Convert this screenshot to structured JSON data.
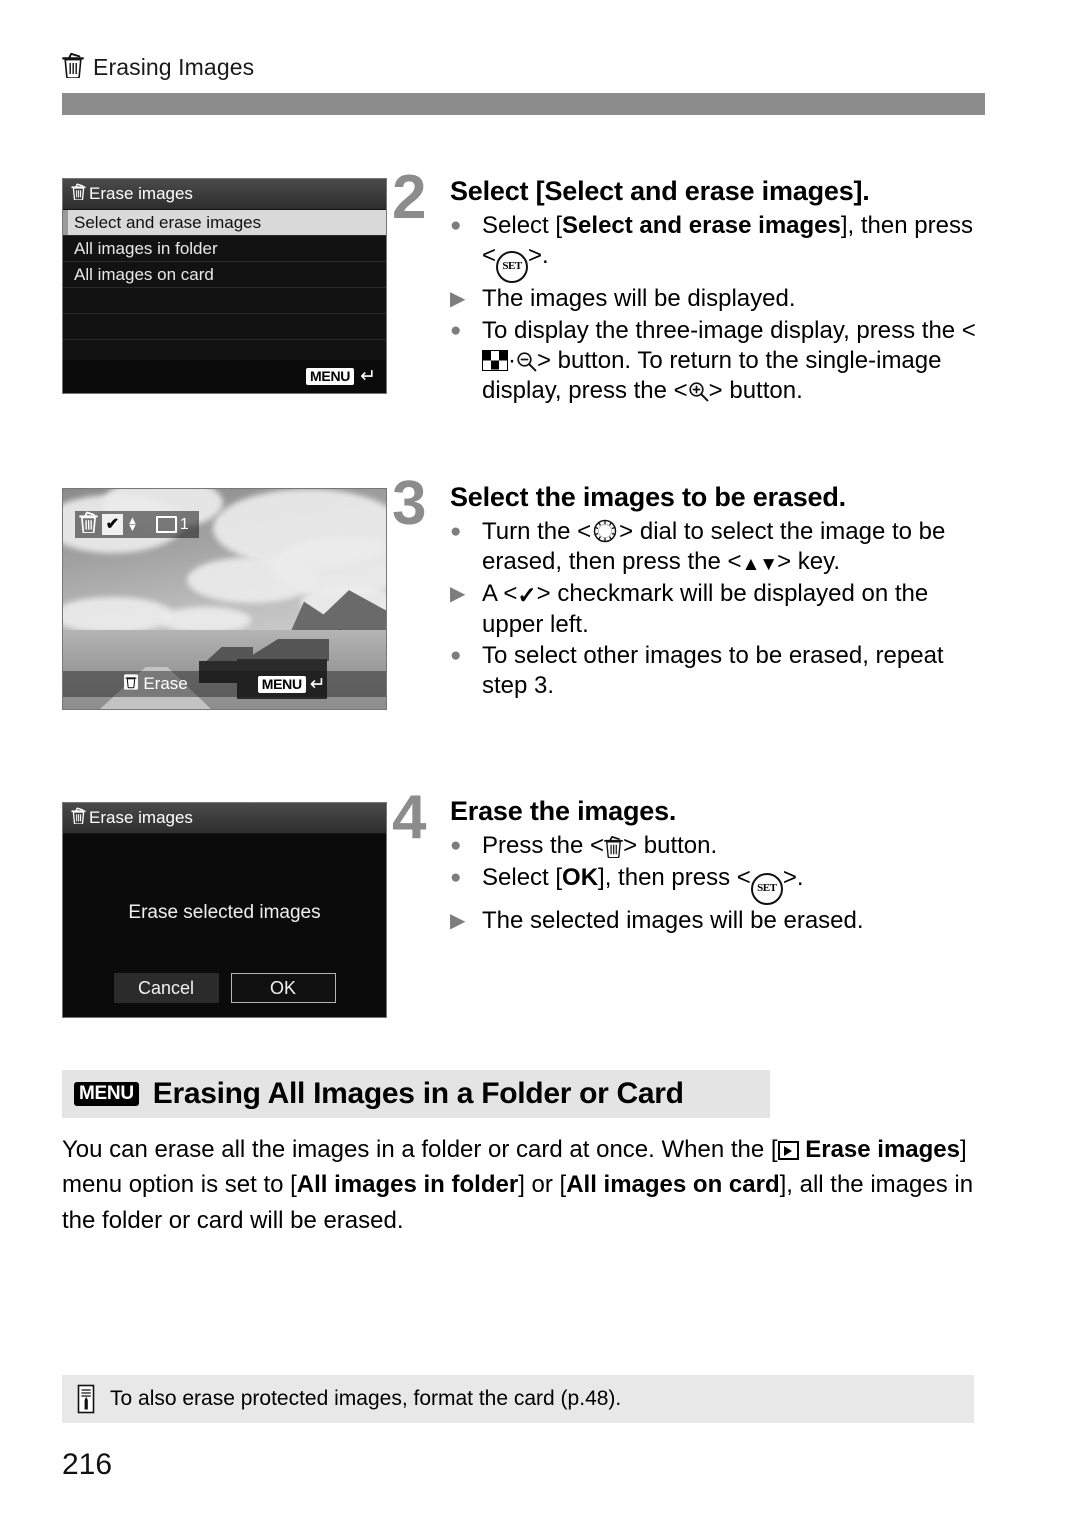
{
  "header": {
    "icon": "trash-icon",
    "title": "Erasing Images"
  },
  "screens": {
    "erase_menu": {
      "title": "Erase images",
      "title_icon": "trash-icon",
      "items": [
        "Select and erase images",
        "All images in folder",
        "All images on card"
      ],
      "selected_index": 0,
      "blank_rows": 3,
      "footer_badge": "MENU",
      "footer_icon": "return-arrow-icon"
    },
    "image_select": {
      "checkmark": "✔",
      "frame_count": "1",
      "trash_icon": "trash-icon",
      "updown_icon": "up-down-arrows-icon",
      "frame_icon": "image-frame-icon",
      "erase_label": "Erase",
      "footer_badge": "MENU",
      "footer_icon": "return-arrow-icon"
    },
    "confirm_dialog": {
      "title": "Erase images",
      "title_icon": "trash-icon",
      "message": "Erase selected images",
      "cancel_label": "Cancel",
      "ok_label": "OK"
    }
  },
  "steps": [
    {
      "number": "2",
      "heading": "Select [Select and erase images].",
      "bullets": [
        {
          "marker": "dot",
          "parts": [
            {
              "t": "Select ["
            },
            {
              "t": "Select and erase images",
              "b": true
            },
            {
              "t": "], then press <"
            },
            {
              "g": "set-icon"
            },
            {
              "t": ">."
            }
          ]
        },
        {
          "marker": "triangle",
          "parts": [
            {
              "t": "The images will be displayed."
            }
          ]
        },
        {
          "marker": "dot",
          "parts": [
            {
              "t": "To display the three-image display, press the <"
            },
            {
              "g": "index-icon"
            },
            {
              "t": "·"
            },
            {
              "g": "magnify-minus-icon"
            },
            {
              "t": "> button. To return to the single-image display, press the <"
            },
            {
              "g": "magnify-plus-icon"
            },
            {
              "t": "> button."
            }
          ]
        }
      ]
    },
    {
      "number": "3",
      "heading": "Select the images to be erased.",
      "bullets": [
        {
          "marker": "dot",
          "parts": [
            {
              "t": "Turn the <"
            },
            {
              "g": "dial-icon"
            },
            {
              "t": "> dial to select the image to be erased, then press the <"
            },
            {
              "g": "updown-key-icon"
            },
            {
              "t": "> key."
            }
          ]
        },
        {
          "marker": "triangle",
          "parts": [
            {
              "t": "A <"
            },
            {
              "g": "checkmark-icon"
            },
            {
              "t": "> checkmark will be displayed on the upper left."
            }
          ]
        },
        {
          "marker": "dot",
          "parts": [
            {
              "t": "To select other images to be erased, repeat step 3."
            }
          ]
        }
      ]
    },
    {
      "number": "4",
      "heading": "Erase the images.",
      "bullets": [
        {
          "marker": "dot",
          "parts": [
            {
              "t": "Press the <"
            },
            {
              "g": "trash-icon"
            },
            {
              "t": "> button."
            }
          ]
        },
        {
          "marker": "dot",
          "parts": [
            {
              "t": "Select ["
            },
            {
              "t": "OK",
              "b": true
            },
            {
              "t": "], then press <"
            },
            {
              "g": "set-icon"
            },
            {
              "t": ">."
            }
          ]
        },
        {
          "marker": "triangle",
          "parts": [
            {
              "t": "The selected images will be erased."
            }
          ]
        }
      ]
    }
  ],
  "section": {
    "badge": "MENU",
    "title": "Erasing All Images in a Folder or Card",
    "paragraph": [
      {
        "t": "You can erase all the images in a folder or card at once. When the ["
      },
      {
        "g": "playback-tab-icon"
      },
      {
        "t": " "
      },
      {
        "t": "Erase images",
        "b": true
      },
      {
        "t": "] menu option is set to ["
      },
      {
        "t": "All images in folder",
        "b": true
      },
      {
        "t": "] or ["
      },
      {
        "t": "All images on card",
        "b": true
      },
      {
        "t": "], all the images in the folder or card will be erased."
      }
    ]
  },
  "footnote": {
    "icon": "note-icon",
    "text": "To also erase protected images, format the card (p.48)."
  },
  "page_number": "216",
  "colors": {
    "rule_bar": "#8c8c8c",
    "step_number": "#8c8c8c",
    "section_band": "#e4e4e4",
    "footnote_band": "#e8e8e8",
    "bullet_marker": "#7d7d7d"
  }
}
